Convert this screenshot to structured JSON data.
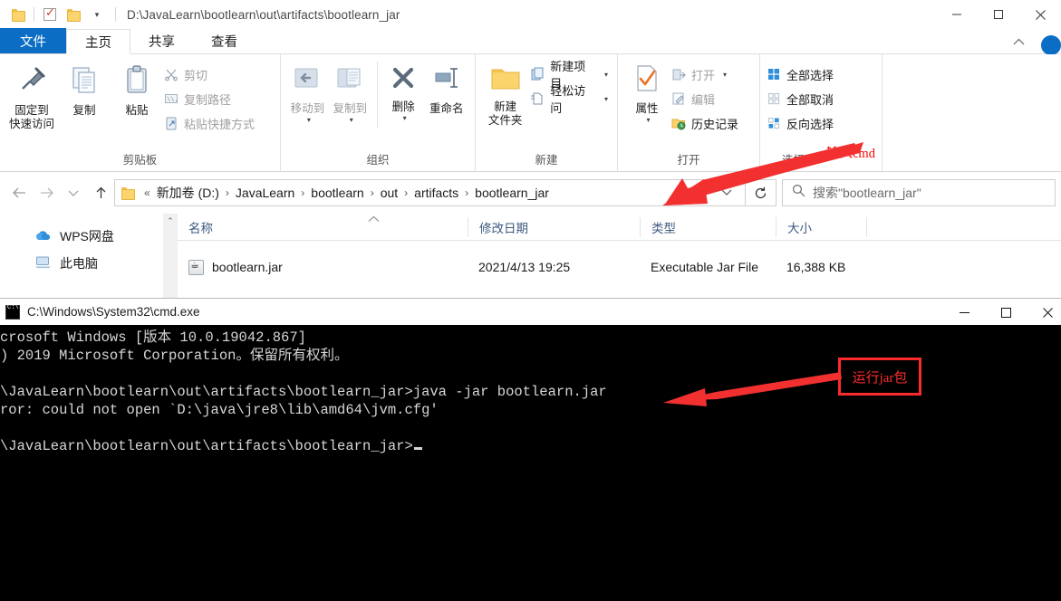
{
  "explorer": {
    "title_path": "D:\\JavaLearn\\bootlearn\\out\\artifacts\\bootlearn_jar",
    "quick_access": [
      {
        "name": "folder-icon",
        "label": "folder"
      },
      {
        "name": "properties-check-icon",
        "label": "properties"
      },
      {
        "name": "new-folder-icon",
        "label": "new folder"
      },
      {
        "name": "customize-caret",
        "label": "▾"
      }
    ],
    "window_controls": {
      "minimize": "—",
      "maximize": "□",
      "close": "✕"
    },
    "tabs": [
      {
        "label": "文件",
        "type": "file"
      },
      {
        "label": "主页",
        "type": "active"
      },
      {
        "label": "共享",
        "type": "normal"
      },
      {
        "label": "查看",
        "type": "normal"
      }
    ],
    "ribbon": {
      "groups": [
        {
          "label": "剪贴板",
          "big": [
            {
              "label": "固定到\n快速访问",
              "icon": "pin-icon"
            },
            {
              "label": "复制",
              "icon": "copy-icon"
            },
            {
              "label": "粘贴",
              "icon": "paste-icon"
            }
          ],
          "small": [
            {
              "label": "剪切",
              "icon": "scissors-icon",
              "dim": true
            },
            {
              "label": "复制路径",
              "icon": "copy-path-icon",
              "dim": true
            },
            {
              "label": "粘贴快捷方式",
              "icon": "paste-shortcut-icon",
              "dim": true
            }
          ]
        },
        {
          "label": "组织",
          "big": [
            {
              "label": "移动到",
              "icon": "move-to-icon",
              "dim": true,
              "caret": true
            },
            {
              "label": "复制到",
              "icon": "copy-to-icon",
              "dim": true,
              "caret": true
            },
            {
              "label": "删除",
              "icon": "delete-icon",
              "caret": true
            },
            {
              "label": "重命名",
              "icon": "rename-icon"
            }
          ],
          "small": []
        },
        {
          "label": "新建",
          "big": [
            {
              "label": "新建\n文件夹",
              "icon": "new-folder-icon"
            }
          ],
          "small": [
            {
              "label": "新建项目",
              "icon": "new-item-icon",
              "caret": true
            },
            {
              "label": "轻松访问",
              "icon": "easy-access-icon",
              "caret": true
            }
          ]
        },
        {
          "label": "打开",
          "big": [
            {
              "label": "属性",
              "icon": "properties-icon",
              "caret": true
            }
          ],
          "small": [
            {
              "label": "打开",
              "icon": "open-icon",
              "dim": true,
              "caret": true
            },
            {
              "label": "编辑",
              "icon": "edit-icon",
              "dim": true
            },
            {
              "label": "历史记录",
              "icon": "history-icon"
            }
          ]
        },
        {
          "label": "选择",
          "big": [],
          "small": [
            {
              "label": "全部选择",
              "icon": "select-all-icon"
            },
            {
              "label": "全部取消",
              "icon": "select-none-icon",
              "dim": true
            },
            {
              "label": "反向选择",
              "icon": "invert-selection-icon"
            }
          ]
        }
      ]
    },
    "address": {
      "back": "←",
      "forward": "→",
      "recent": "⌄",
      "up": "↑",
      "chevron": "⌄",
      "refresh": "↻",
      "breadcrumbs": [
        "«",
        "新加卷 (D:)",
        "JavaLearn",
        "bootlearn",
        "out",
        "artifacts",
        "bootlearn_jar"
      ],
      "separator": "›"
    },
    "search": {
      "placeholder": "搜索\"bootlearn_jar\"",
      "icon": "search-icon"
    },
    "nav_pane": {
      "items": [
        {
          "label": "WPS网盘",
          "icon": "cloud-icon"
        },
        {
          "label": "此电脑",
          "icon": "computer-icon"
        }
      ],
      "scroll_up": "⌃"
    },
    "file_list": {
      "columns": [
        "名称",
        "修改日期",
        "类型",
        "大小"
      ],
      "sort_indicator": "⌃",
      "rows": [
        {
          "name": "bootlearn.jar",
          "modified": "2021/4/13 19:25",
          "type": "Executable Jar File",
          "size": "16,388 KB",
          "icon": "jar-file-icon"
        }
      ]
    }
  },
  "cmd": {
    "title": "C:\\Windows\\System32\\cmd.exe",
    "icon": "cmd-icon",
    "window_controls": {
      "minimize": "—",
      "maximize": "□",
      "close": "✕"
    },
    "lines": [
      "crosoft Windows [版本 10.0.19042.867]",
      ") 2019 Microsoft Corporation。保留所有权利。",
      "",
      "\\JavaLearn\\bootlearn\\out\\artifacts\\bootlearn_jar>java -jar bootlearn.jar",
      "ror: could not open `D:\\java\\jre8\\lib\\amd64\\jvm.cfg'",
      "",
      "\\JavaLearn\\bootlearn\\out\\artifacts\\bootlearn_jar>"
    ]
  },
  "annotations": {
    "cmd_hint": "输入cmd",
    "run_jar_hint": "运行jar包",
    "color": "#ff0000"
  }
}
